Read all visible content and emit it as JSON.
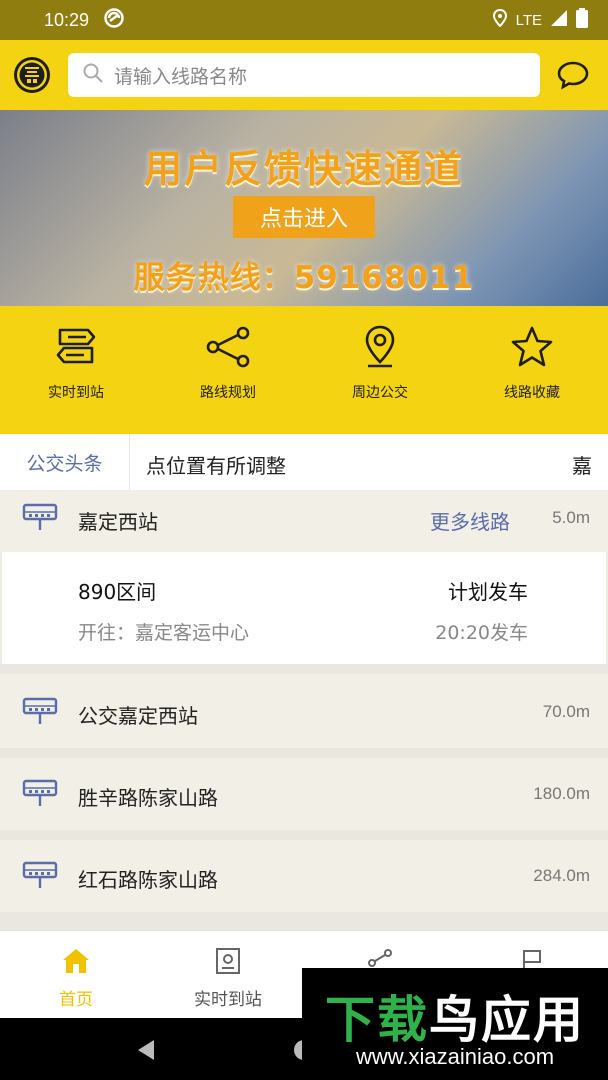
{
  "status_bar": {
    "time": "10:29",
    "network": "LTE"
  },
  "search": {
    "placeholder": "请输入线路名称"
  },
  "banner": {
    "title": "用户反馈快速通道",
    "button": "点击进入",
    "hotline": "服务热线：59168011"
  },
  "quick_actions": [
    {
      "label": "实时到站",
      "icon": "signpost-icon"
    },
    {
      "label": "路线规划",
      "icon": "route-nodes-icon"
    },
    {
      "label": "周边公交",
      "icon": "location-pin-icon"
    },
    {
      "label": "线路收藏",
      "icon": "star-icon"
    }
  ],
  "news": {
    "tag": "公交头条",
    "text": "点位置有所调整",
    "text_next": "嘉"
  },
  "stations": [
    {
      "name": "嘉定西站",
      "more": "更多线路",
      "distance": "5.0m"
    },
    {
      "name": "公交嘉定西站",
      "distance": "70.0m"
    },
    {
      "name": "胜辛路陈家山路",
      "distance": "180.0m"
    },
    {
      "name": "红石路陈家山路",
      "distance": "284.0m"
    }
  ],
  "route": {
    "name": "890区间",
    "destination": "开往：嘉定客运中心",
    "status": "计划发车",
    "time": "20:20发车"
  },
  "bottom_nav": [
    {
      "label": "首页",
      "active": true
    },
    {
      "label": "实时到站",
      "active": false
    }
  ],
  "watermark": {
    "title_part1": "下载",
    "title_part2": "鸟应用",
    "url": "www.xiazainiao.com"
  },
  "colors": {
    "brand_yellow": "#f4d313",
    "accent_blue": "#5b6cab",
    "active_tab": "#f0c200"
  }
}
